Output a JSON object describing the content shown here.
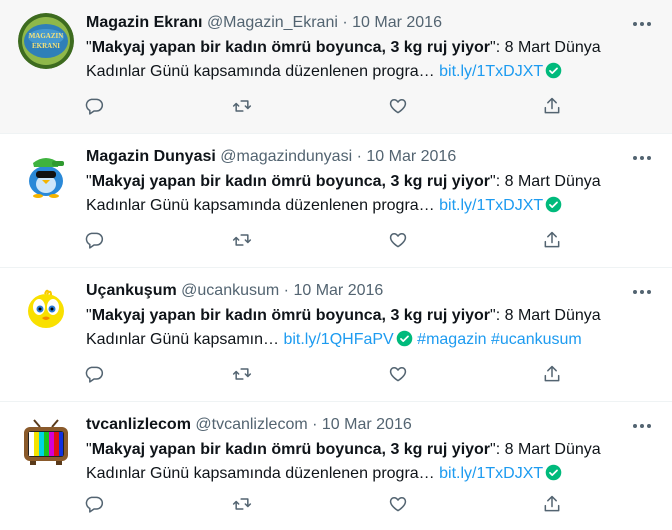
{
  "tweets": [
    {
      "name": "Magazin Ekranı",
      "handle": "@Magazin_Ekrani",
      "separator": "·",
      "date": "10 Mar 2016",
      "quote_open": "\"",
      "bold": "Makyaj yapan bir kadın ömrü boyunca, 3 kg ruj yiyor",
      "quote_close": "\": 8 Mart Dünya",
      "line2": "Kadınlar Günü kapsamında düzenlenen progra…",
      "link": "bit.ly/1TxDJXT",
      "hashtags": "",
      "avatar_text": "MAGAZIN EKRANI"
    },
    {
      "name": "Magazin Dunyasi",
      "handle": "@magazindunyasi",
      "separator": "·",
      "date": "10 Mar 2016",
      "quote_open": "\"",
      "bold": "Makyaj yapan bir kadın ömrü boyunca, 3 kg ruj yiyor",
      "quote_close": "\": 8 Mart Dünya",
      "line2": "Kadınlar Günü kapsamında düzenlenen progra…",
      "link": "bit.ly/1TxDJXT",
      "hashtags": ""
    },
    {
      "name": "Uçankuşum",
      "handle": "@ucankusum",
      "separator": "·",
      "date": "10 Mar 2016",
      "quote_open": "\"",
      "bold": "Makyaj yapan bir kadın ömrü boyunca, 3 kg ruj yiyor",
      "quote_close": "\": 8 Mart Dünya",
      "line2": "Kadınlar Günü kapsamın…",
      "link": "bit.ly/1QHFaPV",
      "hashtags": "#magazin #ucankusum"
    },
    {
      "name": "tvcanlizlecom",
      "handle": "@tvcanlizlecom",
      "separator": "·",
      "date": "10 Mar 2016",
      "quote_open": "\"",
      "bold": "Makyaj yapan bir kadın ömrü boyunca, 3 kg ruj yiyor",
      "quote_close": "\": 8 Mart Dünya",
      "line2": "Kadınlar Günü kapsamında düzenlenen progra…",
      "link": "bit.ly/1TxDJXT",
      "hashtags": ""
    }
  ],
  "icons": {
    "more": "more-icon",
    "reply": "reply-icon",
    "retweet": "retweet-icon",
    "like": "like-icon",
    "share": "share-icon",
    "verified": "verified-check-icon"
  },
  "colors": {
    "link": "#1d9bf0",
    "muted": "#536471",
    "highlight_bg": "#f7f7f7",
    "verified": "#00ba7c"
  }
}
